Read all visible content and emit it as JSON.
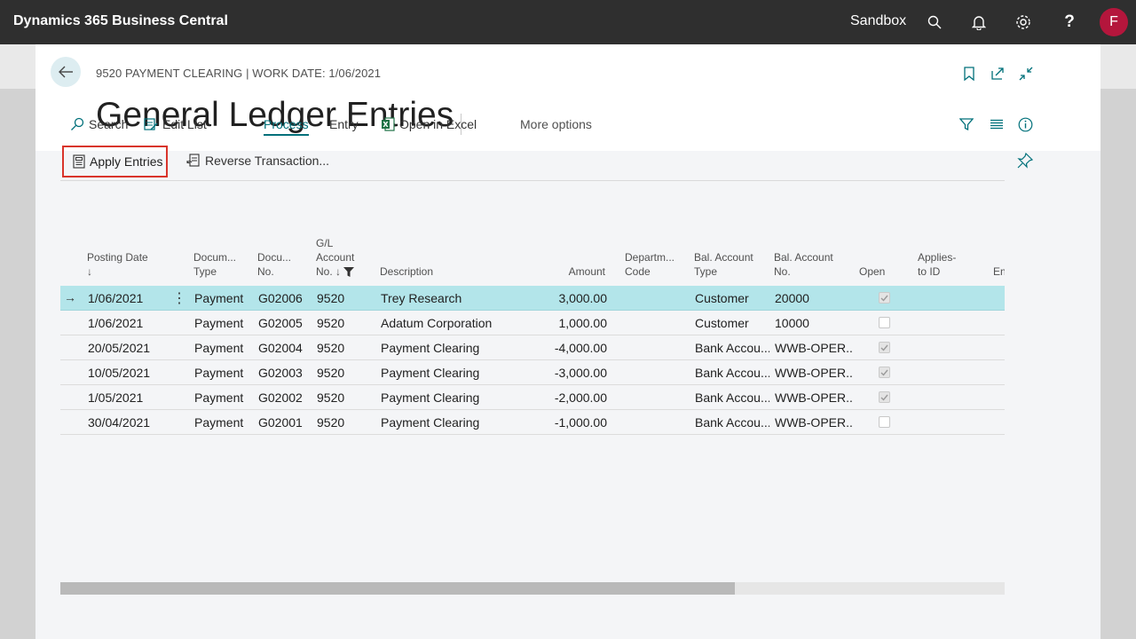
{
  "topbar": {
    "app_title": "Dynamics 365 Business Central",
    "environment": "Sandbox",
    "avatar_initial": "F",
    "avatar_color": "#b4163c"
  },
  "header": {
    "caption": "9520 PAYMENT CLEARING | WORK DATE: 1/06/2021",
    "title": "General Ledger Entries"
  },
  "actions": {
    "search": "Search",
    "edit_list": "Edit List",
    "process": "Process",
    "entry": "Entry",
    "open_in_excel": "Open in Excel",
    "more_options": "More options",
    "apply_entries": "Apply Entries",
    "reverse_transaction": "Reverse Transaction..."
  },
  "columns": {
    "posting_date": [
      "Posting Date",
      "↓"
    ],
    "document_type": [
      "Docum...",
      "Type"
    ],
    "document_no": [
      "Docu...",
      "No."
    ],
    "gl_account_no": [
      "G/L",
      "Account",
      "No. ↓"
    ],
    "description": "Description",
    "amount": "Amount",
    "department_code": [
      "Departm...",
      "Code"
    ],
    "bal_account_type": [
      "Bal. Account",
      "Type"
    ],
    "bal_account_no": [
      "Bal. Account",
      "No."
    ],
    "open": "Open",
    "applies_to_id": [
      "Applies-",
      "to ID"
    ],
    "entry_no_partial": "En"
  },
  "rows": [
    {
      "posting_date": "1/06/2021",
      "document_type": "Payment",
      "document_no": "G02006",
      "gl_account_no": "9520",
      "description": "Trey Research",
      "amount": "3,000.00",
      "bal_account_type": "Customer",
      "bal_account_no": "20000",
      "open": true,
      "selected": true
    },
    {
      "posting_date": "1/06/2021",
      "document_type": "Payment",
      "document_no": "G02005",
      "gl_account_no": "9520",
      "description": "Adatum Corporation",
      "amount": "1,000.00",
      "bal_account_type": "Customer",
      "bal_account_no": "10000",
      "open": false,
      "selected": false
    },
    {
      "posting_date": "20/05/2021",
      "document_type": "Payment",
      "document_no": "G02004",
      "gl_account_no": "9520",
      "description": "Payment Clearing",
      "amount": "-4,000.00",
      "bal_account_type": "Bank Accou...",
      "bal_account_no": "WWB-OPER...",
      "open": true,
      "selected": false
    },
    {
      "posting_date": "10/05/2021",
      "document_type": "Payment",
      "document_no": "G02003",
      "gl_account_no": "9520",
      "description": "Payment Clearing",
      "amount": "-3,000.00",
      "bal_account_type": "Bank Accou...",
      "bal_account_no": "WWB-OPER...",
      "open": true,
      "selected": false
    },
    {
      "posting_date": "1/05/2021",
      "document_type": "Payment",
      "document_no": "G02002",
      "gl_account_no": "9520",
      "description": "Payment Clearing",
      "amount": "-2,000.00",
      "bal_account_type": "Bank Accou...",
      "bal_account_no": "WWB-OPER...",
      "open": true,
      "selected": false
    },
    {
      "posting_date": "30/04/2021",
      "document_type": "Payment",
      "document_no": "G02001",
      "gl_account_no": "9520",
      "description": "Payment Clearing",
      "amount": "-1,000.00",
      "bal_account_type": "Bank Accou...",
      "bal_account_no": "WWB-OPER...",
      "open": false,
      "selected": false
    }
  ],
  "colors": {
    "accent": "#00707a",
    "selected_row": "#b3e5ea",
    "highlight_box": "#d9342b"
  }
}
